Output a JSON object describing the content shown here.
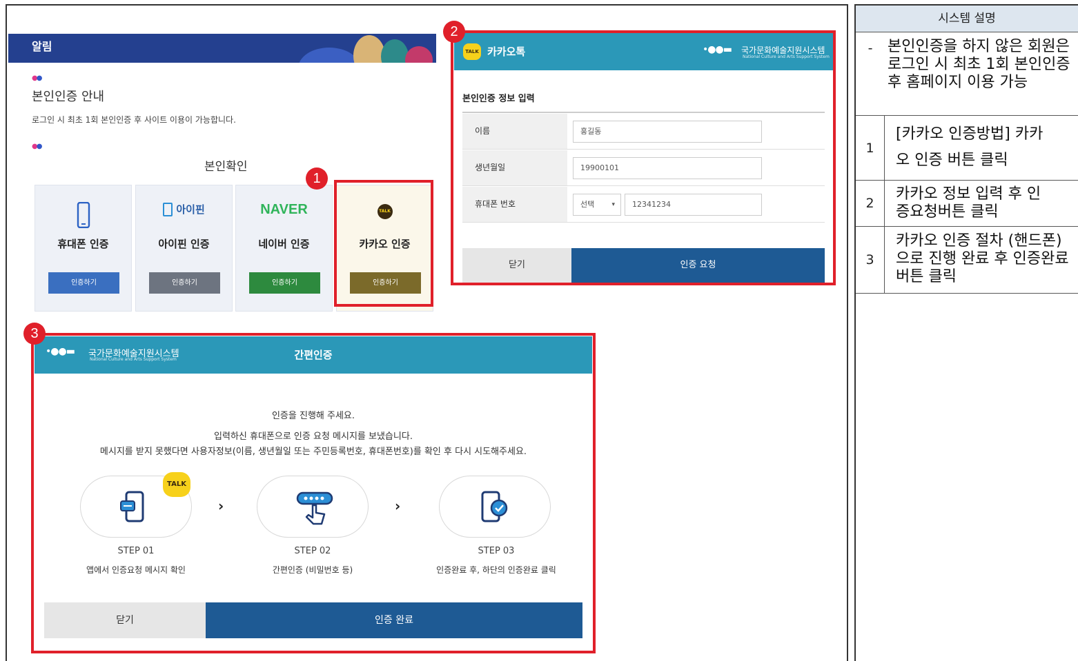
{
  "notice": {
    "header": "알림",
    "guide_title": "본인인증 안내",
    "guide_text": "로그인 시 최초 1회 본인인증 후 사이트 이용이 가능합니다.",
    "verify_title": "본인확인",
    "methods": [
      {
        "label": "휴대폰 인증",
        "button": "인증하기",
        "color": "#3a6fc0"
      },
      {
        "label": "아이핀 인증",
        "button": "인증하기",
        "color": "#6d7480",
        "logo": "아이핀"
      },
      {
        "label": "네이버 인증",
        "button": "인증하기",
        "color": "#2d8a3e",
        "logo": "NAVER"
      },
      {
        "label": "카카오 인증",
        "button": "인증하기",
        "color": "#7b6a2a",
        "logo": "TALK"
      }
    ]
  },
  "badges": [
    "1",
    "2",
    "3"
  ],
  "kakao": {
    "app_name": "카카오톡",
    "org_name_kr": "국가문화예술지원시스템",
    "org_name_en": "National Culture and Arts Support System",
    "form_title": "본인인증 정보 입력",
    "fields": {
      "name_label": "이름",
      "name_value": "홍길동",
      "birth_label": "생년월일",
      "birth_value": "19900101",
      "phone_label": "휴대폰 번호",
      "phone_carrier": "선택",
      "phone_value": "12341234"
    },
    "close_label": "닫기",
    "submit_label": "인증 요청"
  },
  "simple_auth": {
    "title": "간편인증",
    "line1": "인증을 진행해 주세요.",
    "line2": "입력하신 휴대폰으로 인증 요청 메시지를 보냈습니다.",
    "line3": "메시지를 받지 못했다면 사용자정보(이름, 생년월일 또는 주민등록번호, 휴대폰번호)를 확인 후 다시 시도해주세요.",
    "steps": [
      {
        "title": "STEP 01",
        "desc": "앱에서 인증요청 메시지 확인"
      },
      {
        "title": "STEP 02",
        "desc": "간편인증 (비밀번호 등)"
      },
      {
        "title": "STEP 03",
        "desc": "인증완료 후, 하단의 인증완료 클릭"
      }
    ],
    "talk_badge": "TALK",
    "close_label": "닫기",
    "done_label": "인증 완료"
  },
  "system_table": {
    "header": "시스템 설명",
    "rows": [
      {
        "num": "-",
        "text": "본인인증을 하지 않은 회원은 로그인 시 최초 1회 본인인증 후 홈페이지 이용 가능"
      },
      {
        "num": "1",
        "text": "[카카오 인증방법] 카카오 인증 버튼 클릭"
      },
      {
        "num": "2",
        "text": "카카오 정보 입력 후 인증요청버튼 클릭"
      },
      {
        "num": "3",
        "text": "카카오 인증 절차 (핸드폰)으로 진행 완료 후 인증완료 버튼 클릭"
      }
    ]
  }
}
